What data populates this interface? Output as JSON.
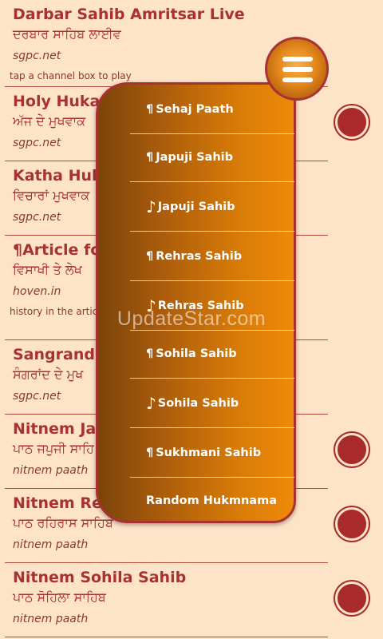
{
  "channels": [
    {
      "title": "Darbar Sahib Amritsar Live",
      "punjabi": "ਦਰਬਾਰ ਸਾਹਿਬ ਲਾਈਵ",
      "source": "sgpc.net",
      "desc": "tap a channel box to play"
    },
    {
      "title": "Holy Hukam",
      "punjabi": "ਅੱਜ ਦੇ ਮੁਖਵਾਕ",
      "source": "sgpc.net",
      "desc": ""
    },
    {
      "title": "Katha Huka",
      "punjabi": "ਵਿਚਾਰਾਂ ਮੁਖਵਾਕ",
      "source": "sgpc.net",
      "desc": ""
    },
    {
      "title": "¶Article for",
      "punjabi": "ਵਿਸਾਖੀ ਤੇ ਲੇਖ",
      "source": "hoven.in",
      "desc": "history in the articl                                         the Sikhs"
    },
    {
      "title": "Sangrand H",
      "punjabi": "ਸੰਗਰਾਂਦ ਦੇ ਮੁਖ",
      "source": "sgpc.net",
      "desc": ""
    },
    {
      "title": "Nitnem Jap",
      "punjabi": "ਪਾਠ ਜਪੁਜੀ ਸਾਹਿ",
      "source": "nitnem paath",
      "desc": ""
    },
    {
      "title": "Nitnem Reh",
      "punjabi": "ਪਾਠ ਰਹਿਰਾਸ ਸਾਹਿਬ",
      "source": "nitnem paath",
      "desc": ""
    },
    {
      "title": "Nitnem Sohila Sahib",
      "punjabi": "ਪਾਠ ਸੋਹਿਲਾ ਸਾਹਿਬ",
      "source": "nitnem paath",
      "desc": ""
    }
  ],
  "menu": {
    "items": [
      {
        "glyph": "¶",
        "label": "Sehaj Paath"
      },
      {
        "glyph": "¶",
        "label": "Japuji Sahib"
      },
      {
        "glyph": "♪",
        "label": "Japuji Sahib"
      },
      {
        "glyph": "¶",
        "label": "Rehras Sahib"
      },
      {
        "glyph": "♪",
        "label": "Rehras Sahib"
      },
      {
        "glyph": "¶",
        "label": "Sohila Sahib"
      },
      {
        "glyph": "♪",
        "label": "Sohila Sahib"
      },
      {
        "glyph": "¶",
        "label": "Sukhmani Sahib"
      },
      {
        "glyph": "",
        "label": "Random Hukmnama"
      }
    ]
  },
  "watermark": "UpdateStar.com",
  "colors": {
    "background": "#fde3c7",
    "accent": "#a83232",
    "menu_gradient_start": "#7a4408",
    "menu_gradient_end": "#f08a08"
  },
  "icons": {
    "menu": "hamburger-icon",
    "play": "play-circle-icon"
  }
}
